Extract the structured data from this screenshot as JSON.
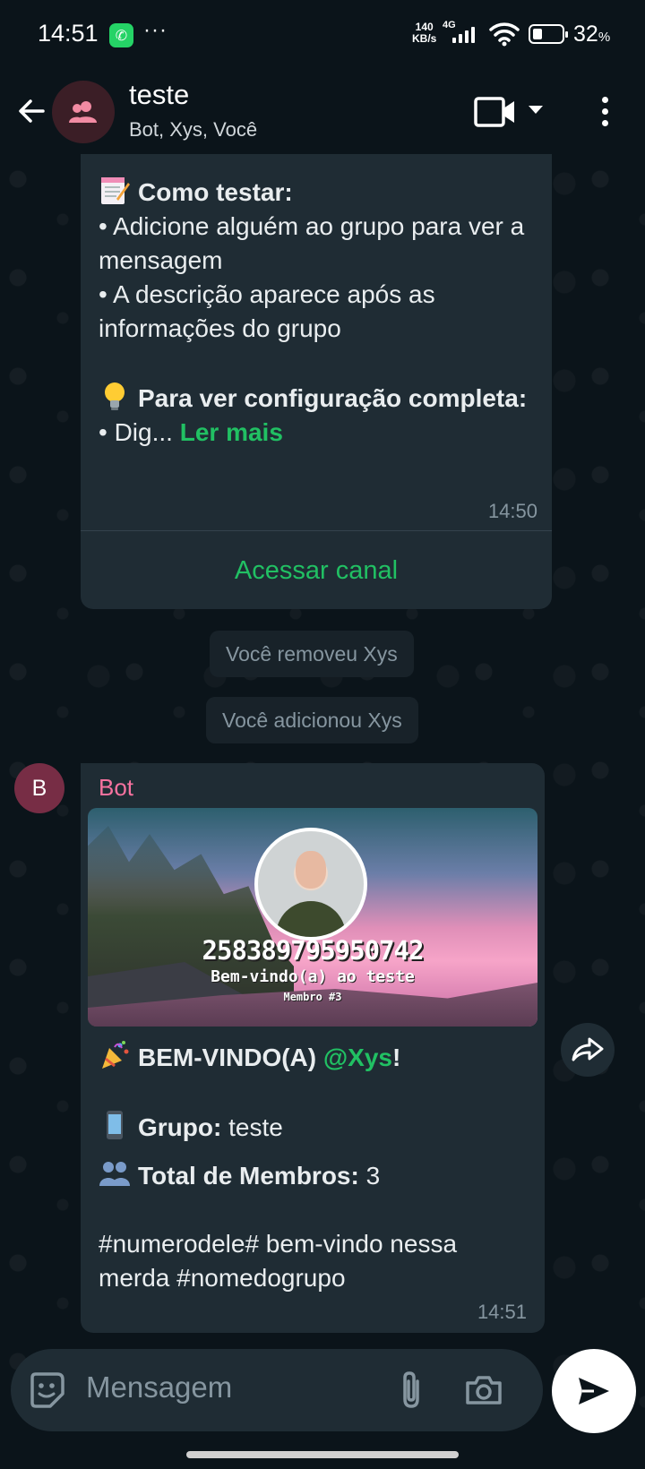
{
  "status_bar": {
    "time": "14:51",
    "dots": "···",
    "speed_value": "140",
    "speed_unit": "KB/s",
    "network": "4G",
    "battery_percent": "32",
    "battery_unit": "%",
    "battery_level": 0.32
  },
  "header": {
    "title": "teste",
    "subtitle": "Bot, Xys, Você"
  },
  "message1": {
    "heading1": "Como testar:",
    "line1": "• Adicione alguém ao grupo para ver a mensagem",
    "line2": "• A descrição aparece após as informações do grupo",
    "heading2": "Para ver configuração completa:",
    "truncated": "• Dig...",
    "read_more": "Ler mais",
    "time": "14:50",
    "channel_button": "Acessar canal"
  },
  "system_messages": [
    "Você removeu Xys",
    "Você adicionou Xys"
  ],
  "message2": {
    "avatar_letter": "B",
    "sender": "Bot",
    "card": {
      "number": "258389795950742",
      "welcome": "Bem-vindo(a) ao teste",
      "member": "Membro #3"
    },
    "welcome_prefix": "BEM-VINDO(A)",
    "mention": "@Xys",
    "welcome_suffix": "!",
    "group_label": "Grupo:",
    "group_value": "teste",
    "members_label": "Total de Membros:",
    "members_value": "3",
    "footer": "#numerodele# bem-vindo nessa merda #nomedogrupo",
    "time": "14:51"
  },
  "input": {
    "placeholder": "Mensagem"
  },
  "colors": {
    "accent": "#21c063",
    "sender": "#f7729f",
    "bubble": "#1f2c34",
    "background": "#0b141a"
  },
  "icons": [
    "back-arrow-icon",
    "group-icon",
    "video-call-icon",
    "more-vert-icon",
    "memo-emoji",
    "bulb-emoji",
    "party-popper-emoji",
    "phone-emoji",
    "people-emoji",
    "forward-icon",
    "sticker-icon",
    "attach-icon",
    "camera-icon",
    "send-icon"
  ]
}
